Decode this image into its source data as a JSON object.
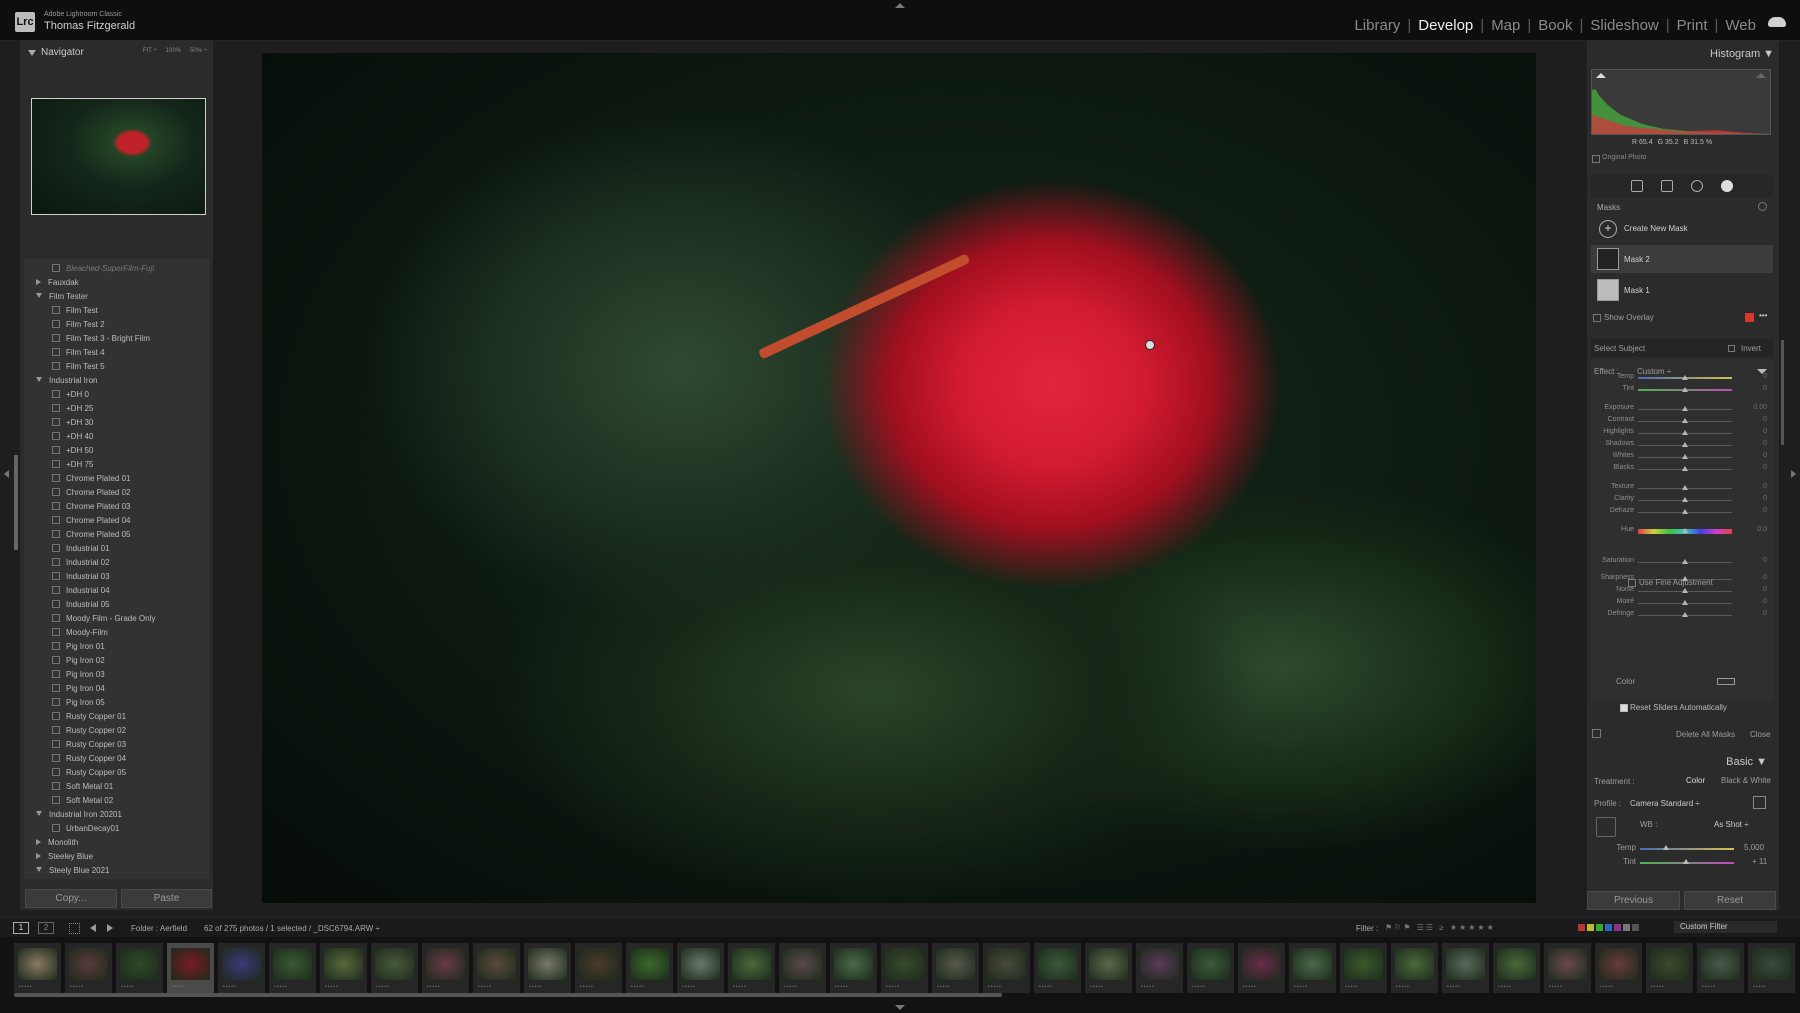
{
  "app": {
    "name": "Adobe Lightroom Classic",
    "user": "Thomas Fitzgerald",
    "logo": "Lrc"
  },
  "modules": [
    "Library",
    "Develop",
    "Map",
    "Book",
    "Slideshow",
    "Print",
    "Web"
  ],
  "active_module": "Develop",
  "navigator": {
    "title": "Navigator",
    "zoom_levels": [
      "FIT ÷",
      "100%",
      "50% ÷"
    ]
  },
  "presets": [
    {
      "label": "Bleached-SuperFilm-Fuji",
      "type": "preset",
      "dim": true
    },
    {
      "label": "Fauxdak",
      "type": "folder-closed"
    },
    {
      "label": "Film Tester",
      "type": "folder-open"
    },
    {
      "label": "Film Test",
      "type": "preset"
    },
    {
      "label": "Film Test 2",
      "type": "preset"
    },
    {
      "label": "Film Test 3 - Bright Film",
      "type": "preset"
    },
    {
      "label": "Film Test 4",
      "type": "preset"
    },
    {
      "label": "Film Test 5",
      "type": "preset"
    },
    {
      "label": "Industrial Iron",
      "type": "folder-open"
    },
    {
      "label": "+DH 0",
      "type": "preset"
    },
    {
      "label": "+DH 25",
      "type": "preset"
    },
    {
      "label": "+DH 30",
      "type": "preset"
    },
    {
      "label": "+DH 40",
      "type": "preset"
    },
    {
      "label": "+DH 50",
      "type": "preset"
    },
    {
      "label": "+DH 75",
      "type": "preset"
    },
    {
      "label": "Chrome Plated 01",
      "type": "preset"
    },
    {
      "label": "Chrome Plated 02",
      "type": "preset"
    },
    {
      "label": "Chrome Plated 03",
      "type": "preset"
    },
    {
      "label": "Chrome Plated 04",
      "type": "preset"
    },
    {
      "label": "Chrome Plated 05",
      "type": "preset"
    },
    {
      "label": "Industrial 01",
      "type": "preset"
    },
    {
      "label": "Industrial 02",
      "type": "preset"
    },
    {
      "label": "Industrial 03",
      "type": "preset"
    },
    {
      "label": "Industrial 04",
      "type": "preset"
    },
    {
      "label": "Industrial 05",
      "type": "preset"
    },
    {
      "label": "Moody Film - Grade Only",
      "type": "preset"
    },
    {
      "label": "Moody-Film",
      "type": "preset"
    },
    {
      "label": "Pig Iron 01",
      "type": "preset"
    },
    {
      "label": "Pig Iron 02",
      "type": "preset"
    },
    {
      "label": "Pig Iron 03",
      "type": "preset"
    },
    {
      "label": "Pig Iron 04",
      "type": "preset"
    },
    {
      "label": "Pig Iron 05",
      "type": "preset"
    },
    {
      "label": "Rusty Copper 01",
      "type": "preset"
    },
    {
      "label": "Rusty Copper 02",
      "type": "preset"
    },
    {
      "label": "Rusty Copper 03",
      "type": "preset"
    },
    {
      "label": "Rusty Copper 04",
      "type": "preset"
    },
    {
      "label": "Rusty Copper 05",
      "type": "preset"
    },
    {
      "label": "Soft Metal 01",
      "type": "preset"
    },
    {
      "label": "Soft Metal 02",
      "type": "preset"
    },
    {
      "label": "Industrial Iron 20201",
      "type": "folder-open"
    },
    {
      "label": "UrbanDecay01",
      "type": "preset"
    },
    {
      "label": "Monolith",
      "type": "folder-closed"
    },
    {
      "label": "Steeley Blue",
      "type": "folder-closed"
    },
    {
      "label": "Steely Blue 2021",
      "type": "folder-open"
    }
  ],
  "left_buttons": {
    "copy": "Copy...",
    "paste": "Paste"
  },
  "histogram": {
    "title": "Histogram ▼",
    "r": "R 65.4",
    "g": "G 35.2",
    "b": "B 31.5 %",
    "original_photo": "Original Photo"
  },
  "masks": {
    "header": "Masks",
    "create_new": "Create New Mask",
    "items": [
      "Mask 2",
      "Mask 1"
    ],
    "show_overlay": "Show Overlay",
    "overlay_color": "#d6372a",
    "select_subject": "Select Subject",
    "invert": "Invert",
    "effect_label": "Effect :",
    "effect_value": "Custom ÷",
    "color_label": "Color",
    "reset_sliders": "Reset Sliders Automatically",
    "delete_all": "Delete All Masks",
    "close": "Close",
    "use_fine_adjustment": "Use Fine Adjustment"
  },
  "sliders": [
    {
      "label": "Temp",
      "value": "0",
      "pos": 0.5,
      "track": "temp"
    },
    {
      "label": "Tint",
      "value": "0",
      "pos": 0.5,
      "track": "tint"
    },
    {
      "label": "Exposure",
      "value": "0.00",
      "pos": 0.5
    },
    {
      "label": "Contrast",
      "value": "0",
      "pos": 0.5
    },
    {
      "label": "Highlights",
      "value": "0",
      "pos": 0.5
    },
    {
      "label": "Shadows",
      "value": "0",
      "pos": 0.5
    },
    {
      "label": "Whites",
      "value": "0",
      "pos": 0.5
    },
    {
      "label": "Blacks",
      "value": "0",
      "pos": 0.5
    },
    {
      "label": "Texture",
      "value": "0",
      "pos": 0.5
    },
    {
      "label": "Clarity",
      "value": "0",
      "pos": 0.5
    },
    {
      "label": "Dehaze",
      "value": "0",
      "pos": 0.5
    },
    {
      "label": "Hue",
      "value": "0.0",
      "pos": 0.5,
      "track": "hue"
    },
    {
      "label": "Saturation",
      "value": "0",
      "pos": 0.5
    },
    {
      "label": "Sharpness",
      "value": "0",
      "pos": 0.5
    },
    {
      "label": "Noise",
      "value": "0",
      "pos": 0.5
    },
    {
      "label": "Moiré",
      "value": "0",
      "pos": 0.5
    },
    {
      "label": "Defringe",
      "value": "0",
      "pos": 0.5
    }
  ],
  "basic": {
    "title": "Basic ▼",
    "treatment_label": "Treatment :",
    "treatment_color": "Color",
    "treatment_bw": "Black & White",
    "profile_label": "Profile :",
    "profile_value": "Camera Standard ÷",
    "wb_label": "WB :",
    "wb_value": "As Shot ÷",
    "temp_label": "Temp",
    "temp_value": "5,000",
    "tint_label": "Tint",
    "tint_value": "+ 11"
  },
  "right_buttons": {
    "previous": "Previous",
    "reset": "Reset"
  },
  "filmbar": {
    "page1": "1",
    "page2": "2",
    "folder": "Folder : Aerfield",
    "count": "62 of 275 photos / 1 selected / _DSC6794.ARW ÷",
    "filter_label": "Filter :",
    "custom_filter": "Custom Filter"
  },
  "filmstrip_colors": [
    "#8a7a62",
    "#5a3a3a",
    "#2e4a28",
    "#7a1a22",
    "#3a3a7a",
    "#3a5a32",
    "#5a6a3a",
    "#4a5a3a",
    "#6a3a4a",
    "#5a4a3a",
    "#7a7a6a",
    "#4a3a2a",
    "#3a6a2a",
    "#6a7a6a",
    "#4a6a3a",
    "#5a4a4a",
    "#4a6a4a",
    "#3a4a2a",
    "#5a5a4a",
    "#4a4a3a",
    "#3a5a3a",
    "#5a6a4a",
    "#5a3a5a",
    "#3a5a3a",
    "#6a2a4a",
    "#4a6a4a",
    "#3a5a2a",
    "#4a6a3a",
    "#5a6a5a",
    "#4a6a3a",
    "#6a4a4a",
    "#6a3a3a",
    "#3a4a2a",
    "#4a5a4a",
    "#3a4a3a"
  ]
}
